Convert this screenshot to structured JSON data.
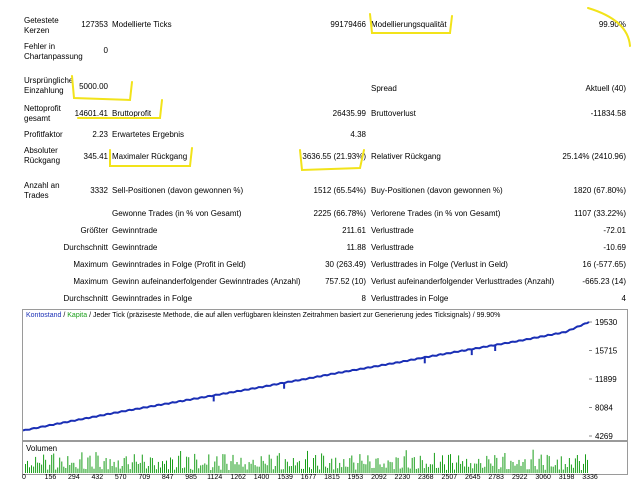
{
  "report": {
    "row1": {
      "label": "Getestete Kerzen",
      "value": "127353",
      "label2": "Modellierte Ticks",
      "value2": "99179466",
      "label3": "Modellierungsqualität",
      "value3": "99.90%"
    },
    "row2": {
      "label": "Fehler in Chartanpassung",
      "value": "0"
    },
    "row3": {
      "label": "Ursprüngliche Einzahlung",
      "value": "5000.00",
      "label3": "Spread",
      "value3": "Aktuell (40)"
    },
    "row4": {
      "label": "Nettoprofit gesamt",
      "value": "14601.41",
      "label2": "Bruttoprofit",
      "value2": "26435.99",
      "label3": "Bruttoverlust",
      "value3": "-11834.58"
    },
    "row5": {
      "label": "Profitfaktor",
      "value": "2.23",
      "label2": "Erwartetes Ergebnis",
      "value2": "4.38"
    },
    "row6": {
      "label": "Absoluter Rückgang",
      "value": "345.41",
      "label2": "Maximaler Rückgang",
      "value2": "3636.55 (21.93%)",
      "label3": "Relativer Rückgang",
      "value3": "25.14% (2410.96)"
    },
    "row7": {
      "label": "Anzahl an Trades",
      "value": "3332",
      "label2": "Sell-Positionen (davon gewonnen %)",
      "value2": "1512 (65.54%)",
      "label3": "Buy-Positionen (davon gewonnen %)",
      "value3": "1820 (67.80%)"
    },
    "row8": {
      "label2": "Gewonne Trades (in % von Gesamt)",
      "value2": "2225 (66.78%)",
      "label3": "Verlorene Trades (in % von Gesamt)",
      "value3": "1107 (33.22%)"
    },
    "row9": {
      "label": "Größter",
      "label2": "Gewinntrade",
      "value2": "211.61",
      "label3": "Verlusttrade",
      "value3": "-72.01"
    },
    "row10": {
      "label": "Durchschnitt",
      "label2": "Gewinntrade",
      "value2": "11.88",
      "label3": "Verlusttrade",
      "value3": "-10.69"
    },
    "row11": {
      "label": "Maximum",
      "label2": "Gewinntrades in Folge (Profit in Geld)",
      "value2": "30 (263.49)",
      "label3": "Verlusttrades in Folge (Verlust in Geld)",
      "value3": "16 (-577.65)"
    },
    "row12": {
      "label": "Maximum",
      "label2": "Gewinn aufeinanderfolgender Gewinntrades (Anzahl)",
      "value2": "757.52 (10)",
      "label3": "Verlust aufeinanderfolgender Verlusttrades (Anzahl)",
      "value3": "-665.23 (14)"
    },
    "row13": {
      "label": "Durchschnitt",
      "label2": "Gewinntrades in Folge",
      "value2": "8",
      "label3": "Verlusttrades in Folge",
      "value3": "4"
    }
  },
  "chart": {
    "legend_balance": "Kontostand",
    "legend_sep1": " / ",
    "legend_equity": "Kapita",
    "legend_rest": " / Jeder Tick (präziseste Methode, die auf allen verfügbaren kleinsten Zeitrahmen basiert zur Generierung jedes Ticksignals) / 99.90%",
    "volume_label": "Volumen",
    "colors": {
      "balance": "#1a2fb5",
      "equity": "#1a9e1a",
      "volume": "#1a9e1a",
      "highlight": "#f2e31a"
    }
  },
  "chart_data": {
    "type": "line",
    "series": [
      {
        "name": "Kontostand",
        "x": [
          0,
          156,
          294,
          432,
          570,
          709,
          847,
          985,
          1124,
          1262,
          1400,
          1539,
          1677,
          1815,
          1953,
          2092,
          2230,
          2368,
          2507,
          2645,
          2783,
          2922,
          3060,
          3198,
          3336
        ],
        "values": [
          5000,
          5700,
          6300,
          6900,
          7500,
          8050,
          8600,
          9150,
          9700,
          10250,
          10800,
          11400,
          11950,
          12550,
          13100,
          13650,
          14200,
          14800,
          15350,
          15900,
          16450,
          17000,
          17600,
          18200,
          19530
        ]
      }
    ],
    "yticks": [
      "19530",
      "15715",
      "11899",
      "8084",
      "4269"
    ],
    "ytick_values": [
      19530,
      15715,
      11899,
      8084,
      4269
    ],
    "xticks": [
      "0",
      "156",
      "294",
      "432",
      "570",
      "709",
      "847",
      "985",
      "1124",
      "1262",
      "1400",
      "1539",
      "1677",
      "1815",
      "1953",
      "2092",
      "2230",
      "2368",
      "2507",
      "2645",
      "2783",
      "2922",
      "3060",
      "3198",
      "3336"
    ],
    "ylim": [
      4269,
      19530
    ],
    "xlim": [
      0,
      3336
    ]
  }
}
